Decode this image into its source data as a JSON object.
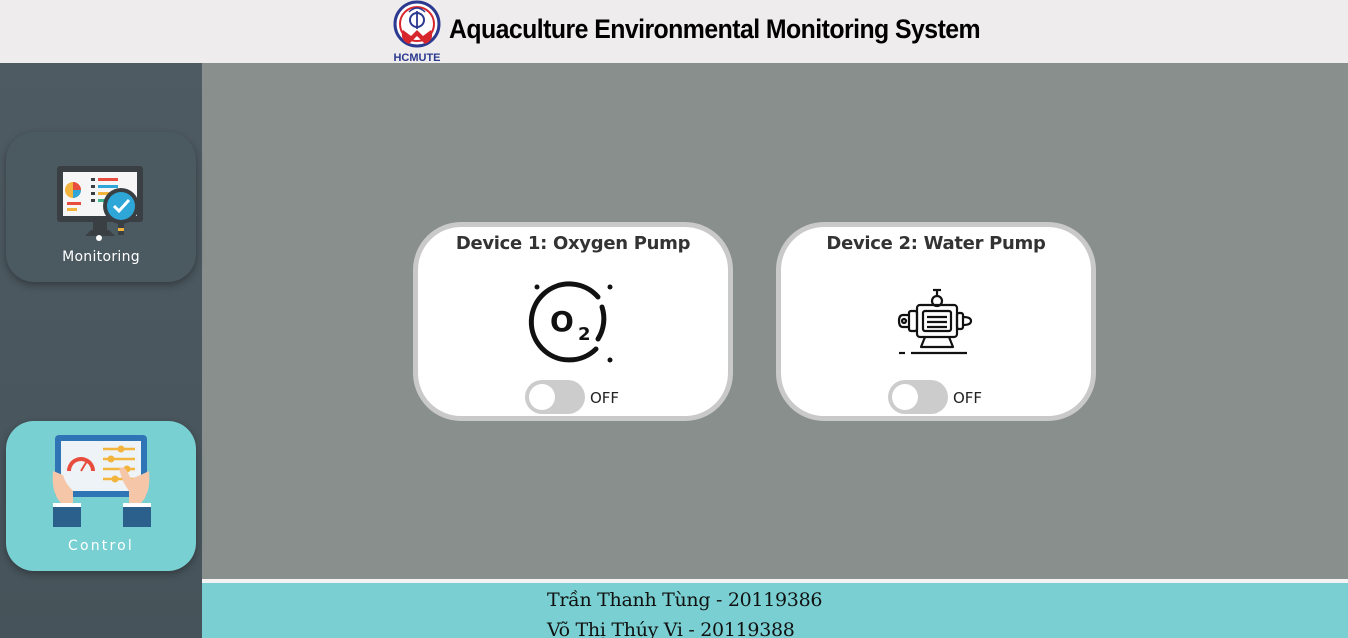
{
  "header": {
    "title": "Aquaculture Environmental Monitoring System",
    "logo_text": "HCMUTE"
  },
  "sidebar": {
    "items": [
      {
        "label": "Monitoring",
        "icon": "monitor-dashboard-icon",
        "active": false
      },
      {
        "label": "Control",
        "icon": "tablet-control-icon",
        "active": true
      }
    ]
  },
  "devices": [
    {
      "title": "Device 1: Oxygen Pump",
      "icon": "oxygen-o2-icon",
      "state": "OFF"
    },
    {
      "title": "Device 2: Water Pump",
      "icon": "water-pump-icon",
      "state": "OFF"
    }
  ],
  "footer": {
    "authors": [
      "Trần Thanh Tùng - 20119386",
      "Võ Thị Thúy Vi - 20119388"
    ]
  },
  "colors": {
    "header_bg": "#efeced",
    "sidebar_bg": "#4f5b63",
    "main_bg": "#888f8c",
    "accent_teal": "#79d0d3",
    "card_border": "#c9c9c9",
    "toggle_off": "#cccccc"
  }
}
